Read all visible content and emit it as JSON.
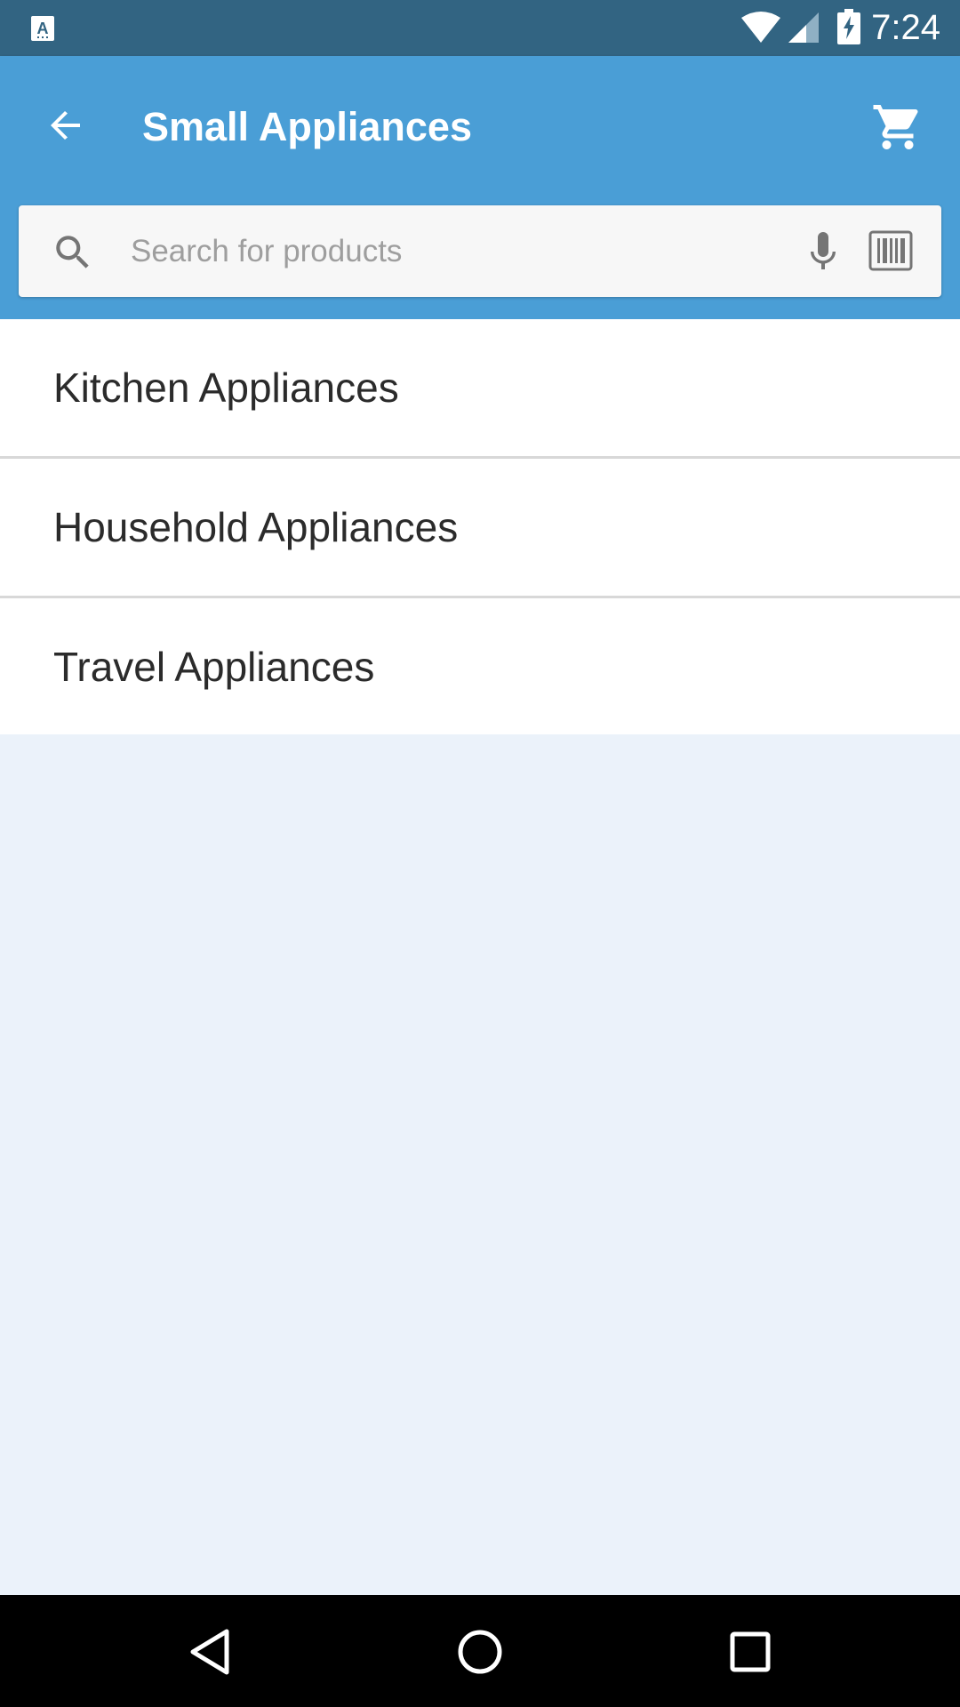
{
  "status_bar": {
    "time": "7:24",
    "notification_icon": "keyboard-a-icon",
    "wifi_icon": "wifi-icon",
    "signal_icon": "cell-signal-icon",
    "battery_icon": "battery-charging-icon"
  },
  "app_bar": {
    "title": "Small Appliances",
    "back_icon": "arrow-back-icon",
    "cart_icon": "shopping-cart-icon"
  },
  "search": {
    "placeholder": "Search for products",
    "value": "",
    "search_icon": "search-icon",
    "mic_icon": "microphone-icon",
    "barcode_icon": "barcode-scan-icon"
  },
  "categories": [
    {
      "label": "Kitchen Appliances"
    },
    {
      "label": "Household Appliances"
    },
    {
      "label": "Travel Appliances"
    }
  ],
  "nav_bar": {
    "back_icon": "nav-back-icon",
    "home_icon": "nav-home-icon",
    "recents_icon": "nav-recents-icon"
  },
  "colors": {
    "status_bar": "#326482",
    "app_bar": "#4a9ed6",
    "background": "#ebf2fa",
    "list_bg": "#ffffff",
    "text": "#2b2b2b"
  }
}
